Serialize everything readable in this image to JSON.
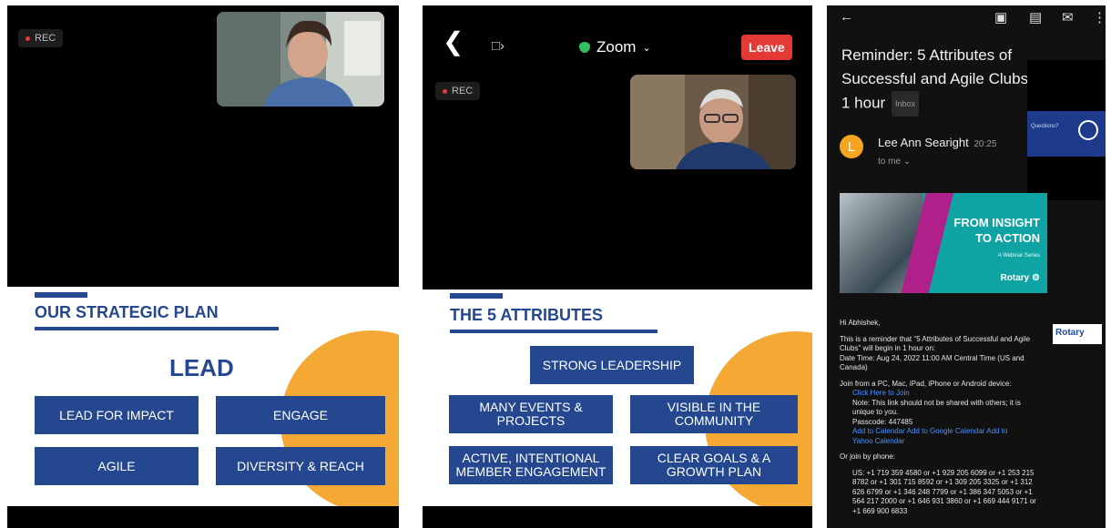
{
  "panel1": {
    "rec_label": "REC",
    "slide": {
      "title": "OUR STRATEGIC PLAN",
      "heading": "LEAD",
      "boxes": [
        "LEAD FOR IMPACT",
        "ENGAGE",
        "AGILE",
        "DIVERSITY & REACH"
      ]
    }
  },
  "panel2": {
    "back_icon": "chevron-left-icon",
    "speaker_icon": "speaker-bluetooth-icon",
    "meeting_name": "Zoom",
    "leave_label": "Leave",
    "rec_label": "REC",
    "slide": {
      "title": "THE 5 ATTRIBUTES",
      "boxes": [
        "STRONG LEADERSHIP",
        "MANY EVENTS & PROJECTS",
        "VISIBLE IN THE COMMUNITY",
        "ACTIVE, INTENTIONAL MEMBER ENGAGEMENT",
        "CLEAR GOALS & A GROWTH PLAN"
      ]
    }
  },
  "panel3": {
    "icons": [
      "back-arrow-icon",
      "archive-icon",
      "delete-icon",
      "mail-icon",
      "more-icon"
    ],
    "subject": "Reminder: 5 Attributes of Successful and Agile Clubs starts in 1 hour",
    "inbox_label": "Inbox",
    "avatar_letter": "L",
    "sender": "Lee Ann Searight",
    "time": "20:25",
    "to": "to me",
    "overlay_text": "Questions?",
    "banner": {
      "heading_line1": "FROM INSIGHT",
      "heading_line2": "TO ACTION",
      "subtitle": "A Webinar Series",
      "brand": "Rotary"
    },
    "side_logo": "Rotary",
    "greeting": "Hi Abhishek,",
    "reminder": "This is a reminder that \"5 Attributes of Successful and Agile Clubs\" will begin in 1 hour on:",
    "datetime": "Date Time: Aug 24, 2022 11:00 AM Central Time (US and Canada)",
    "join_device": "Join from a PC, Mac, iPad, iPhone or Android device:",
    "click_join": "Click Here to Join",
    "note": "Note: This link should not be shared with others; it is unique to you.",
    "passcode": "Passcode: 447485",
    "add_cal": "Add to Calendar",
    "add_google": "Add to Google Calendar",
    "add_yahoo_a": "Add to",
    "add_yahoo_b": "Yahoo Calendar",
    "join_phone": "Or join by phone:",
    "phones": "US: +1 719 359 4580 or +1 929 205 6099 or +1 253 215 8782 or +1 301 715 8592 or +1 309 205 3325 or +1 312 626 6799 or +1 346 248 7799 or +1 386 347 5053 or +1 564 217 2000 or +1 646 931 3860 or +1 669 444 9171 or +1 669 900 6833"
  }
}
